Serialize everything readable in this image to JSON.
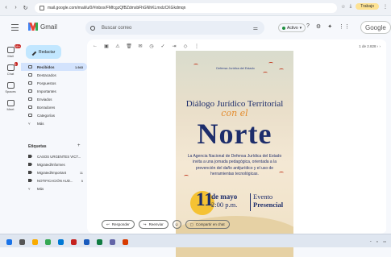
{
  "browser": {
    "url": "mail.google.com/mail/u/0/#inbox/FMfcgzQfBZdmxbFhGNhKLmxlzCKGkdmqn",
    "profile": "Trabajo"
  },
  "gmail": {
    "app_name": "Gmail",
    "search_placeholder": "Buscar correo",
    "status": "Activo",
    "account_button": "Google"
  },
  "rail": {
    "mail_label": "Mail",
    "mail_badge": "99+",
    "chat_label": "Chat",
    "chat_badge": "1",
    "spaces_label": "Spaces",
    "meet_label": "Meet"
  },
  "compose": {
    "label": "Redactar"
  },
  "folders": [
    {
      "label": "Recibidos",
      "count": "1.943",
      "selected": true
    },
    {
      "label": "Destacados",
      "count": ""
    },
    {
      "label": "Pospuestos",
      "count": ""
    },
    {
      "label": "Importantes",
      "count": ""
    },
    {
      "label": "Enviados",
      "count": ""
    },
    {
      "label": "Borradores",
      "count": ""
    },
    {
      "label": "Categorías",
      "count": ""
    },
    {
      "label": "Más",
      "count": ""
    }
  ],
  "labels_section": {
    "title": "Etiquetas",
    "add": "+"
  },
  "labels": [
    {
      "label": "CASOS URGENTES VICT...",
      "count": ""
    },
    {
      "label": "Migrated/Informes",
      "count": ""
    },
    {
      "label": "Migrated/Important",
      "count": "11"
    },
    {
      "label": "NOTIFICACIÓN AUD...",
      "count": "5"
    },
    {
      "label": "Más",
      "count": ""
    }
  ],
  "message": {
    "pager": "1 de 2.828"
  },
  "poster": {
    "logo_text": "Defensa Jurídica del Estado",
    "title_line1": "Diálogo Jurídico Territorial",
    "title_script": "con el",
    "title_big": "Norte",
    "body": "La Agencia Nacional de Defensa Jurídica del Estado invita a una jornada pedagógica, orientada a la prevención del daño antijurídico y el uso de herramientas tecnológicas.",
    "day": "11",
    "month": "de mayo",
    "time": "2:00 p.m.",
    "event_line1": "Evento",
    "event_line2": "Presencial"
  },
  "actions": {
    "reply": "Responder",
    "forward": "Reenviar",
    "emoji": "☺",
    "chat": "Compartir en chat"
  },
  "colors": {
    "accent": "#c2e7ff",
    "selected": "#d3e3fd",
    "poster_navy": "#1d2d6b",
    "poster_yellow": "#f5c233",
    "poster_orange": "#e38c2e"
  }
}
